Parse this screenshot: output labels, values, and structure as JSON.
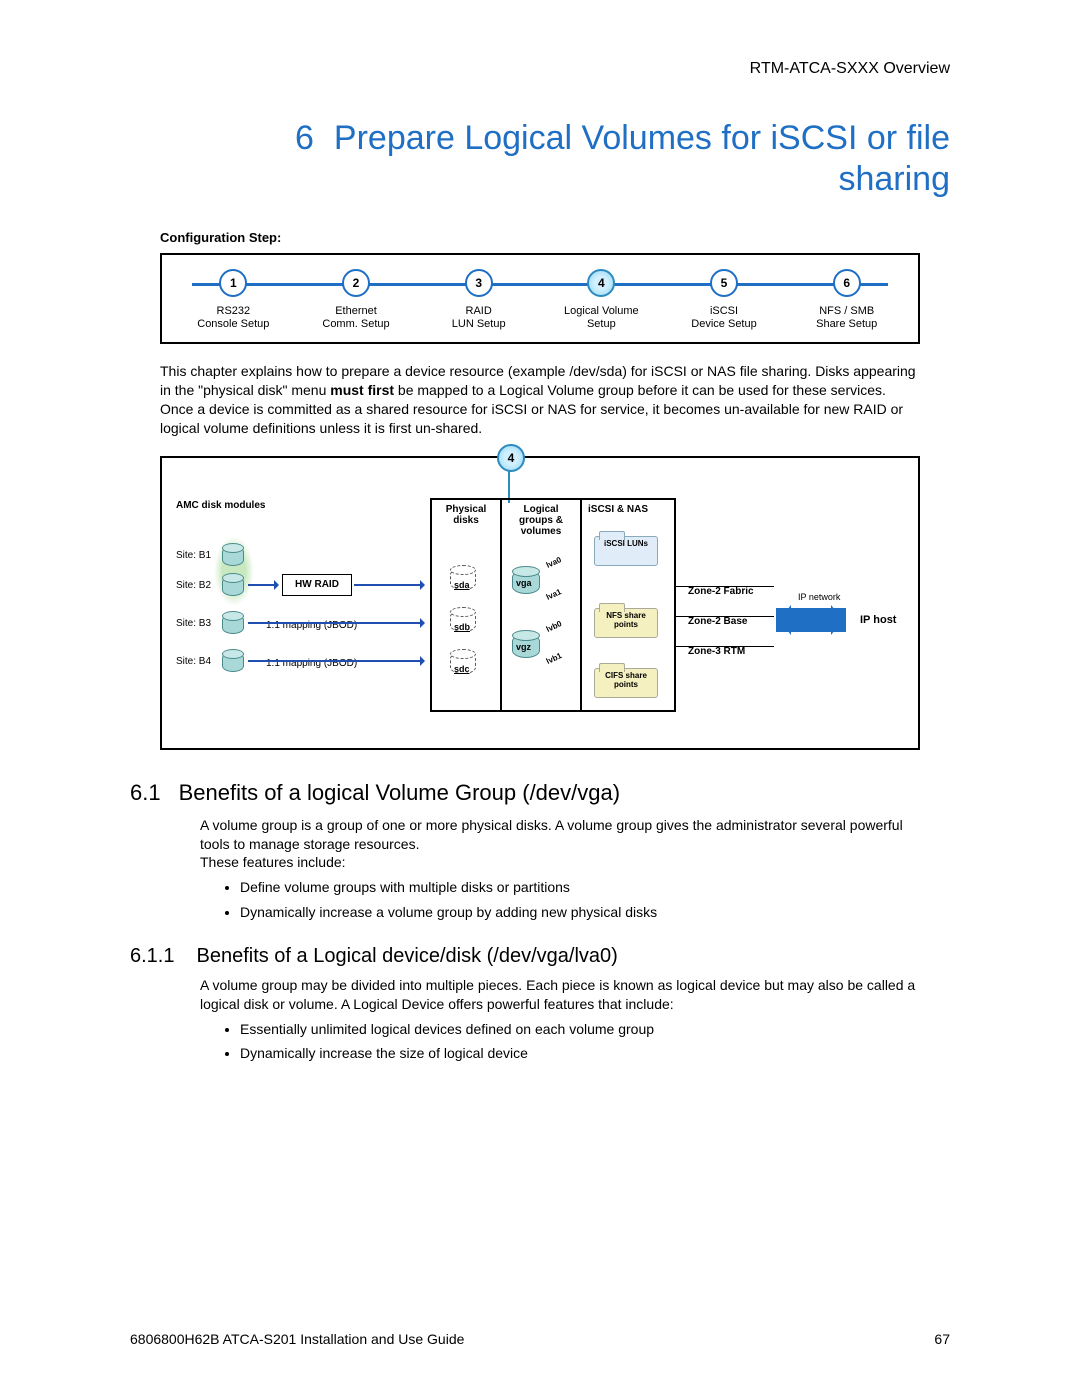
{
  "header": {
    "right": "RTM-ATCA-SXXX Overview"
  },
  "chapter": {
    "number": "6",
    "title": "Prepare Logical Volumes for iSCSI or file sharing"
  },
  "config_step_label": "Configuration Step:",
  "steps": [
    {
      "n": "1",
      "l1": "RS232",
      "l2": "Console Setup",
      "active": false
    },
    {
      "n": "2",
      "l1": "Ethernet",
      "l2": "Comm. Setup",
      "active": false
    },
    {
      "n": "3",
      "l1": "RAID",
      "l2": "LUN Setup",
      "active": false
    },
    {
      "n": "4",
      "l1": "Logical Volume",
      "l2": "Setup",
      "active": true
    },
    {
      "n": "5",
      "l1": "iSCSI",
      "l2": "Device Setup",
      "active": false
    },
    {
      "n": "6",
      "l1": "NFS / SMB",
      "l2": "Share Setup",
      "active": false
    }
  ],
  "intro": {
    "p1a": "This chapter explains how to prepare a device resource (example /dev/sda) for iSCSI or NAS file sharing.  Disks appearing in the \"physical disk\" menu ",
    "bold": "must first",
    "p1b": " be mapped to a Logical Volume group before it can be used for these services. Once a device is committed as a shared resource for iSCSI or NAS for service, it becomes un-available for new RAID or logical volume definitions unless it is first un-shared."
  },
  "diagram": {
    "callout": "4",
    "amc_title": "AMC disk modules",
    "sites": [
      "Site: B1",
      "Site: B2",
      "Site: B3",
      "Site: B4"
    ],
    "hw_raid": "HW RAID",
    "mapping": "1:1 mapping (JBOD)",
    "phys_title": "Physical disks",
    "phys_disks": [
      "sda",
      "sdb",
      "sdc"
    ],
    "log_title": "Logical groups & volumes",
    "vgs": [
      "vga",
      "vgz"
    ],
    "lvs": [
      "lva0",
      "lva1",
      "lvb0",
      "lvb1"
    ],
    "nas_title": "iSCSI & NAS",
    "folders": {
      "iscsi": "iSCSI LUNs",
      "nfs": "NFS share points",
      "cifs": "CIFS share points"
    },
    "zones": [
      "Zone-2 Fabric",
      "Zone-2 Base",
      "Zone-3 RTM"
    ],
    "ip_network": "IP network",
    "ip_host": "IP host"
  },
  "s61": {
    "num": "6.1",
    "title": "Benefits of a logical Volume Group (/dev/vga)",
    "p1": "A volume group is a group of one or more physical disks.  A volume group gives the administrator several powerful tools to manage storage resources.",
    "p2": "These features include:",
    "b1": "Define volume groups with multiple disks or partitions",
    "b2": "Dynamically increase a volume group by adding new physical disks"
  },
  "s611": {
    "num": "6.1.1",
    "title": "Benefits of a Logical device/disk (/dev/vga/lva0)",
    "p1": "A volume group may be divided into multiple pieces.  Each piece is known as logical device but may also be called a logical disk or volume.  A Logical Device offers powerful features that include:",
    "b1": "Essentially unlimited logical devices defined on each volume group",
    "b2": "Dynamically increase the size of logical device"
  },
  "footer": {
    "left": "6806800H62B ATCA-S201 Installation and Use Guide",
    "right": "67"
  }
}
